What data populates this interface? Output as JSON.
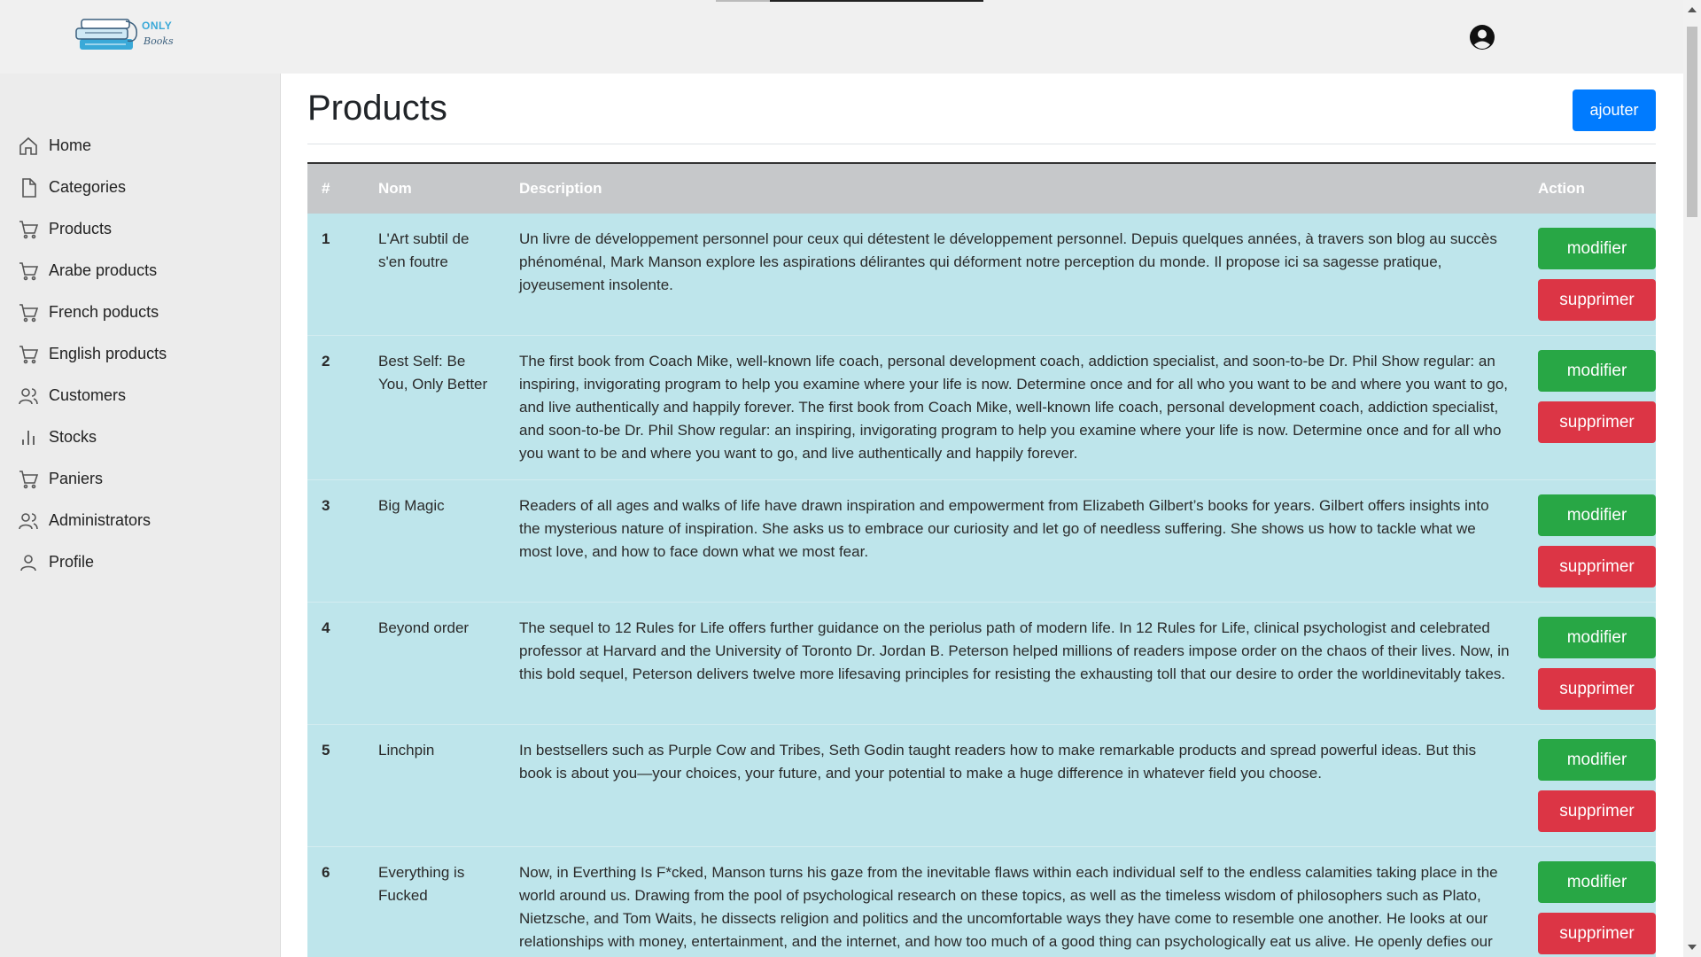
{
  "brand": {
    "line1": "ONLY",
    "line2": "Books",
    "primary_color": "#3aa9d8"
  },
  "header": {
    "account_icon": "user-circle-icon"
  },
  "sidebar": {
    "items": [
      {
        "label": "Home",
        "icon": "home-icon"
      },
      {
        "label": "Categories",
        "icon": "file-icon"
      },
      {
        "label": "Products",
        "icon": "cart-icon"
      },
      {
        "label": "Arabe products",
        "icon": "cart-icon"
      },
      {
        "label": "French poducts",
        "icon": "cart-icon"
      },
      {
        "label": "English products",
        "icon": "cart-icon"
      },
      {
        "label": "Customers",
        "icon": "users-icon"
      },
      {
        "label": "Stocks",
        "icon": "bar-chart-icon"
      },
      {
        "label": "Paniers",
        "icon": "cart-icon"
      },
      {
        "label": "Administrators",
        "icon": "users-icon"
      },
      {
        "label": "Profile",
        "icon": "user-icon"
      }
    ]
  },
  "main": {
    "title": "Products",
    "add_label": "ajouter",
    "table": {
      "headers": {
        "num": "#",
        "name": "Nom",
        "description": "Description",
        "action": "Action"
      },
      "edit_label": "modifier",
      "delete_label": "supprimer",
      "rows": [
        {
          "num": "1",
          "name": "L'Art subtil de s'en foutre",
          "description": "Un livre de développement personnel pour ceux qui détestent le développement personnel. Depuis quelques années, à travers son blog au succès phénoménal, Mark Manson explore les aspirations délirantes qui déforment notre perception du monde. Il propose ici sa sagesse pratique, joyeusement insolente."
        },
        {
          "num": "2",
          "name": "Best Self: Be You, Only Better",
          "description": "The first book from Coach Mike, well-known life coach, personal development coach, addiction specialist, and soon-to-be Dr. Phil Show regular: an inspiring, invigorating program to help you examine where your life is now. Determine once and for all who you want to be and where you want to go, and live authentically and happily forever. The first book from Coach Mike, well-known life coach, personal development coach, addiction specialist, and soon-to-be Dr. Phil Show regular: an inspiring, invigorating program to help you examine where your life is now. Determine once and for all who you want to be and where you want to go, and live authentically and happily forever."
        },
        {
          "num": "3",
          "name": "Big Magic",
          "description": "Readers of all ages and walks of life have drawn inspiration and empowerment from Elizabeth Gilbert’s books for years. Gilbert offers insights into the mysterious nature of inspiration. She asks us to embrace our curiosity and let go of needless suffering. She shows us how to tackle what we most love, and how to face down what we most fear."
        },
        {
          "num": "4",
          "name": "Beyond order",
          "description": "The sequel to 12 Rules for Life offers further guidance on the periolus path of modern life. In 12 Rules for Life, clinical psychologist and celebrated professor at Harvard and the University of Toronto Dr. Jordan B. Peterson helped millions of readers impose order on the chaos of their lives. Now, in this bold sequel, Peterson delivers twelve more lifesaving principles for resisting the exhausting toll that our desire to order the worldinevitably takes."
        },
        {
          "num": "5",
          "name": "Linchpin",
          "description": "In bestsellers such as Purple Cow and Tribes, Seth Godin taught readers how to make remarkable products and spread powerful ideas. But this book is about you—your choices, your future, and your potential to make a huge difference in whatever field you choose."
        },
        {
          "num": "6",
          "name": "Everything is Fucked",
          "description": "Now, in Everthing Is F*cked, Manson turns his gaze from the inevitable flaws within each individual self to the endless calamities taking place in the world around us. Drawing from the pool of psychological research on these topics, as well as the timeless wisdom of philosophers such as Plato, Nietzsche, and Tom Waits, he dissects religion and politics and the uncomfortable ways they have come to resemble one another. He looks at our relationships with money, entertainment, and the internet, and how too much of a good thing can psychologically eat us alive. He openly defies our definitions of faith, happiness, freedom—and even of hope itself."
        }
      ]
    }
  },
  "colors": {
    "primary": "#007bff",
    "success": "#28a745",
    "danger": "#dc3545",
    "row_bg": "#bee5eb",
    "header_bg": "#c6c8ca"
  }
}
